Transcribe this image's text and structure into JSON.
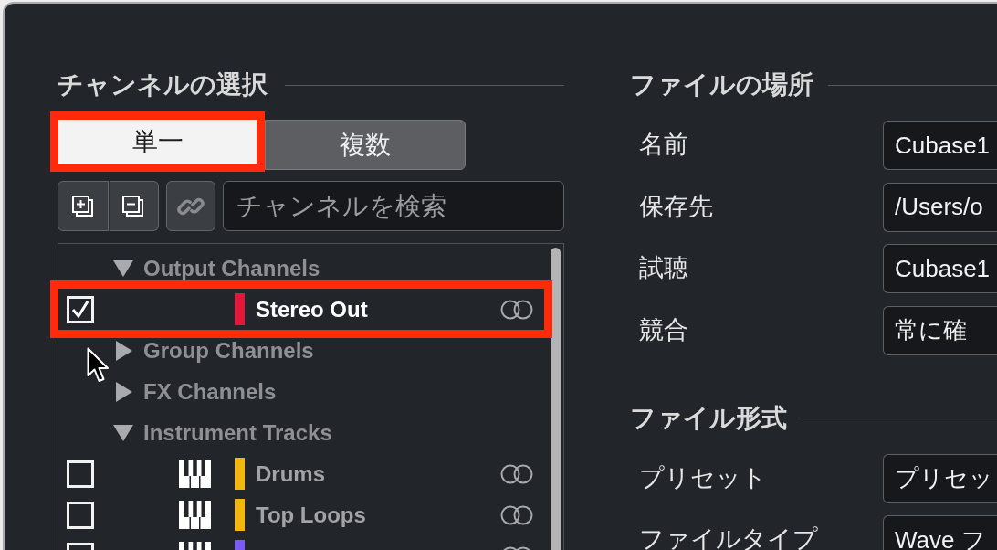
{
  "channel_selection": {
    "title": "チャンネルの選択",
    "modes": [
      {
        "label": "単一",
        "selected": true,
        "highlighted": true
      },
      {
        "label": "複数",
        "selected": false,
        "highlighted": false
      }
    ],
    "search": {
      "placeholder": "チャンネルを検索"
    },
    "tree": [
      {
        "label": "Output Channels",
        "expanded": true,
        "children": [
          {
            "kind": "output",
            "name": "Stereo Out",
            "color": "#e0193a",
            "checked": true,
            "highlighted": true
          }
        ]
      },
      {
        "label": "Group Channels",
        "expanded": false
      },
      {
        "label": "FX Channels",
        "expanded": false
      },
      {
        "label": "Instrument Tracks",
        "expanded": true,
        "children": [
          {
            "kind": "instrument",
            "name": "Drums",
            "color": "#f0b70f",
            "checked": false,
            "highlighted": false
          },
          {
            "kind": "instrument",
            "name": "Top Loops",
            "color": "#f0b70f",
            "checked": false,
            "highlighted": false
          },
          {
            "kind": "instrument",
            "color": "#7a5cf4",
            "checked": false,
            "highlighted": false
          }
        ]
      }
    ]
  },
  "file_location": {
    "title": "ファイルの場所",
    "fields": [
      {
        "label": "名前",
        "value": "Cubase1"
      },
      {
        "label": "保存先",
        "value": "/Users/o"
      },
      {
        "label": "試聴",
        "value": "Cubase1"
      },
      {
        "label": "競合",
        "value": "常に確"
      }
    ]
  },
  "file_format": {
    "title": "ファイル形式",
    "fields": [
      {
        "label": "プリセット",
        "value": "プリセッ"
      },
      {
        "label": "ファイルタイプ",
        "value": "Wave フ"
      }
    ]
  }
}
